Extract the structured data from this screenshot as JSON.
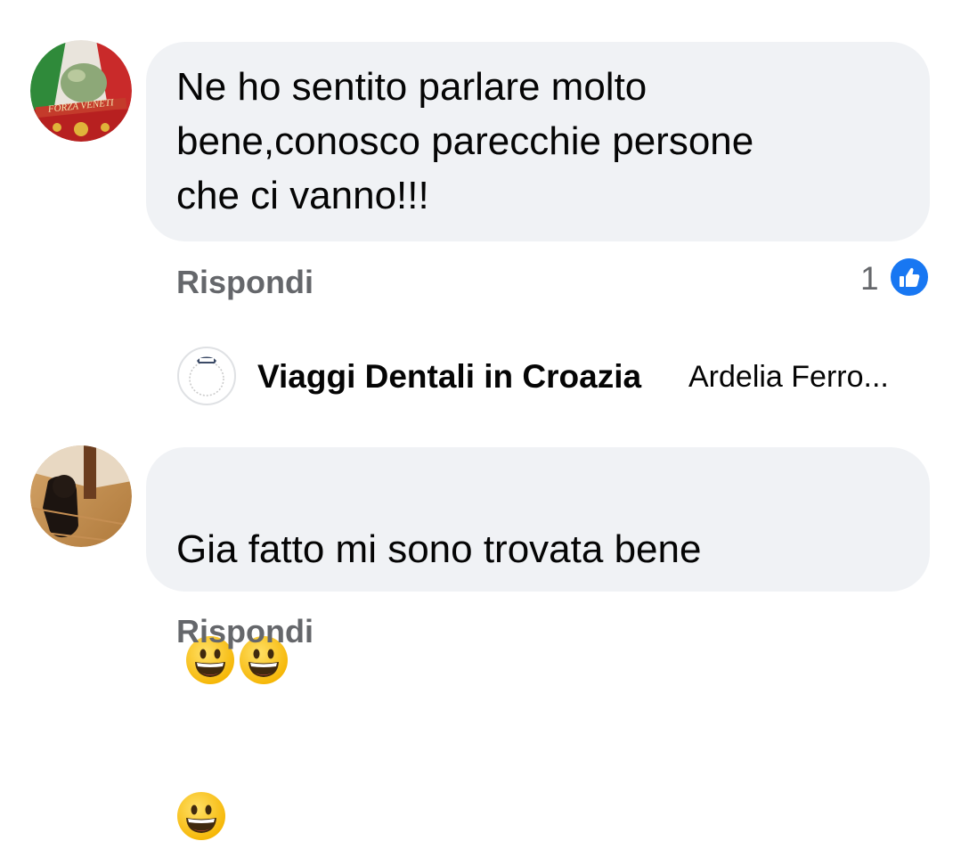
{
  "comments": [
    {
      "avatar_icon": "user-avatar-icon",
      "avatar_text": "FORZA VENETI",
      "text": "Ne ho sentito parlare molto\nbene,conosco parecchie persone\nche ci vanno!!!",
      "reply_label": "Rispondi",
      "like_count": "1",
      "like_icon": "like-thumb-icon"
    },
    {
      "avatar_icon": "user-avatar-icon",
      "text": "Gia fatto mi sono trovata bene",
      "emojis": [
        "grinning-face-emoji",
        "grinning-face-emoji",
        "grinning-face-emoji"
      ],
      "reply_label": "Rispondi"
    }
  ],
  "reply_thread": {
    "author": "Viaggi Dentali in Croazia",
    "snippet": "Ardelia Ferro...",
    "avatar_icon": "page-avatar-icon"
  },
  "colors": {
    "bubble": "#f0f2f5",
    "text": "#050505",
    "muted": "#65676b",
    "like_blue": "#1877f2"
  }
}
